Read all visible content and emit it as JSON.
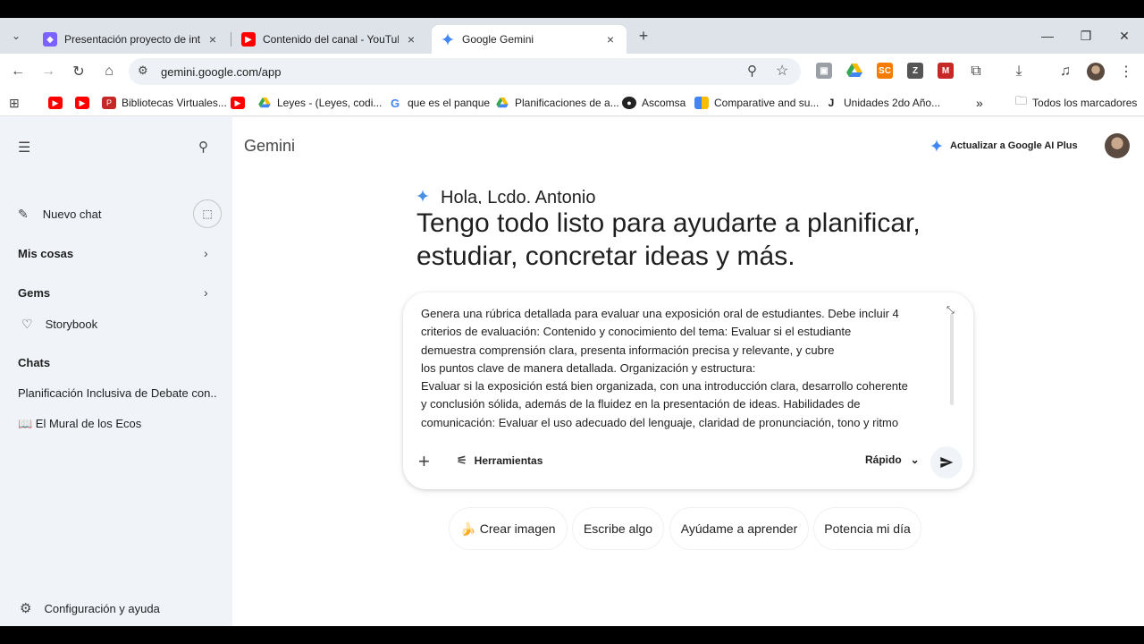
{
  "browser": {
    "tabs": [
      {
        "title": "Presentación proyecto de inteli",
        "close": "×"
      },
      {
        "title": "Contenido del canal - YouTube",
        "close": "×"
      },
      {
        "title": "Google Gemini",
        "close": "×"
      }
    ],
    "new_tab": "+",
    "url": "gemini.google.com/app",
    "bookmarks": [
      {
        "label": "Bibliotecas Virtuales..."
      },
      {
        "label": "Leyes - (Leyes, codi..."
      },
      {
        "label": "que es el panque"
      },
      {
        "label": "Planificaciones de a..."
      },
      {
        "label": "Ascomsa"
      },
      {
        "label": "Comparative and su..."
      },
      {
        "label": "Unidades 2do Año..."
      }
    ],
    "overflow": "»",
    "all_bookmarks": "Todos los marcadores"
  },
  "sidebar": {
    "new_chat": "Nuevo chat",
    "my_stuff": "Mis cosas",
    "gems": "Gems",
    "storybook": "Storybook",
    "chats_heading": "Chats",
    "chats": [
      {
        "label": "Planificación Inclusiva de Debate con..."
      },
      {
        "label": "📖 El Mural de los Ecos"
      }
    ],
    "settings": "Configuración y ayuda"
  },
  "main": {
    "app_title": "Gemini",
    "upgrade_label": "Actualizar a Google AI Plus",
    "greeting": "Hola, Lcdo. Antonio",
    "headline": "Tengo todo listo para ayudarte a planificar, estudiar, concretar ideas y más.",
    "prompt_text": "Genera una rúbrica detallada para evaluar una exposición oral de estudiantes. Debe incluir 4\ncriterios de evaluación: Contenido y conocimiento del tema: Evaluar si el estudiante\ndemuestra comprensión clara, presenta información precisa y relevante, y cubre\nlos puntos clave de manera detallada. Organización y estructura:\nEvaluar si la exposición está bien organizada, con una introducción clara, desarrollo coherente\ny conclusión sólida, además de la fluidez en la presentación de ideas. Habilidades de\ncomunicación: Evaluar el uso adecuado del lenguaje, claridad de pronunciación, tono y ritmo",
    "tools_label": "Herramientas",
    "mode_label": "Rápido",
    "chips": [
      {
        "label": "🍌 Crear imagen"
      },
      {
        "label": "Escribe algo"
      },
      {
        "label": "Ayúdame a aprender"
      },
      {
        "label": "Potencia mi día"
      }
    ]
  },
  "colors": {
    "accent": "#1a73e8",
    "page_bg": "#f0f4f9"
  }
}
